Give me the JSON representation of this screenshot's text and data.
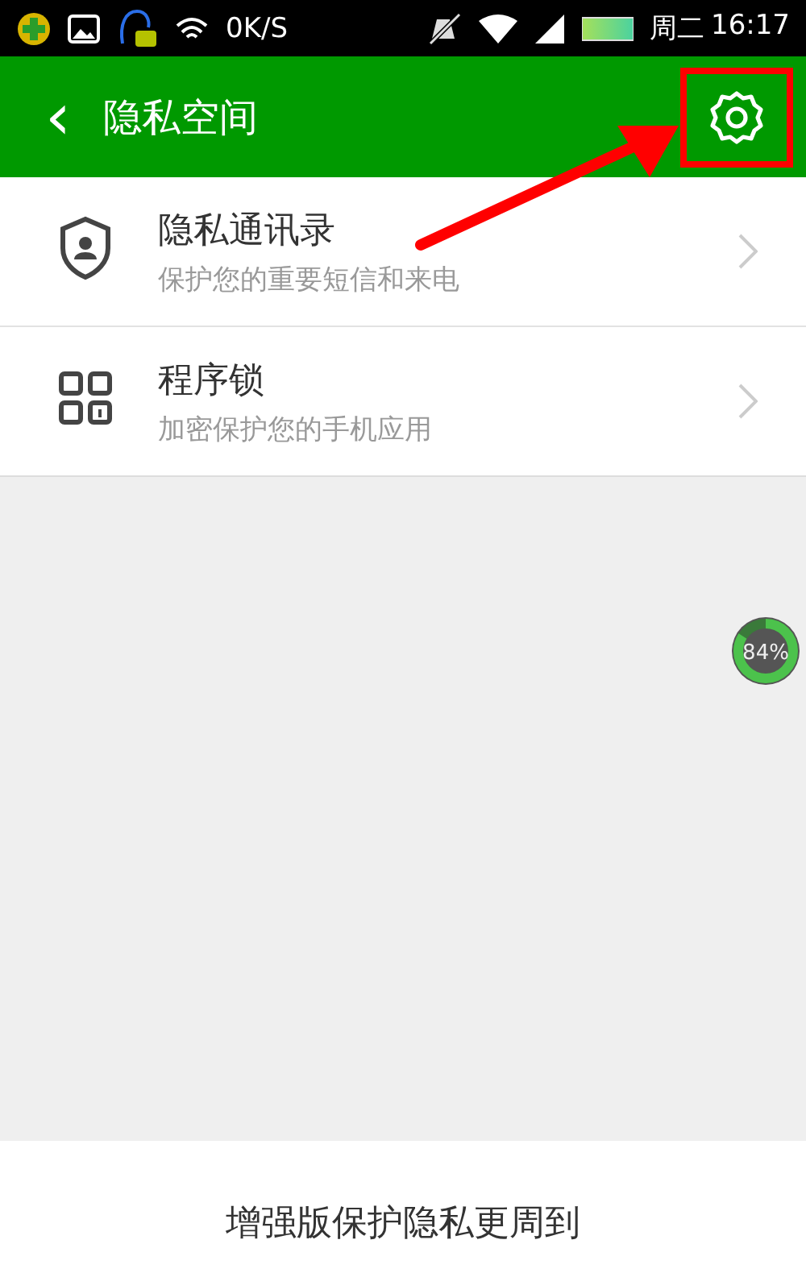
{
  "status_bar": {
    "speed": "0K/S",
    "weekday": "周二",
    "time": "16:17"
  },
  "header": {
    "back": "‹",
    "title": "隐私空间"
  },
  "items": [
    {
      "kind": "contacts",
      "title": "隐私通讯录",
      "subtitle": "保护您的重要短信和来电"
    },
    {
      "kind": "applock",
      "title": "程序锁",
      "subtitle": "加密保护您的手机应用"
    }
  ],
  "floating_ball": {
    "reading": "84%",
    "level": 0.84
  },
  "footer": {
    "text": "增强版保护隐私更周到"
  }
}
